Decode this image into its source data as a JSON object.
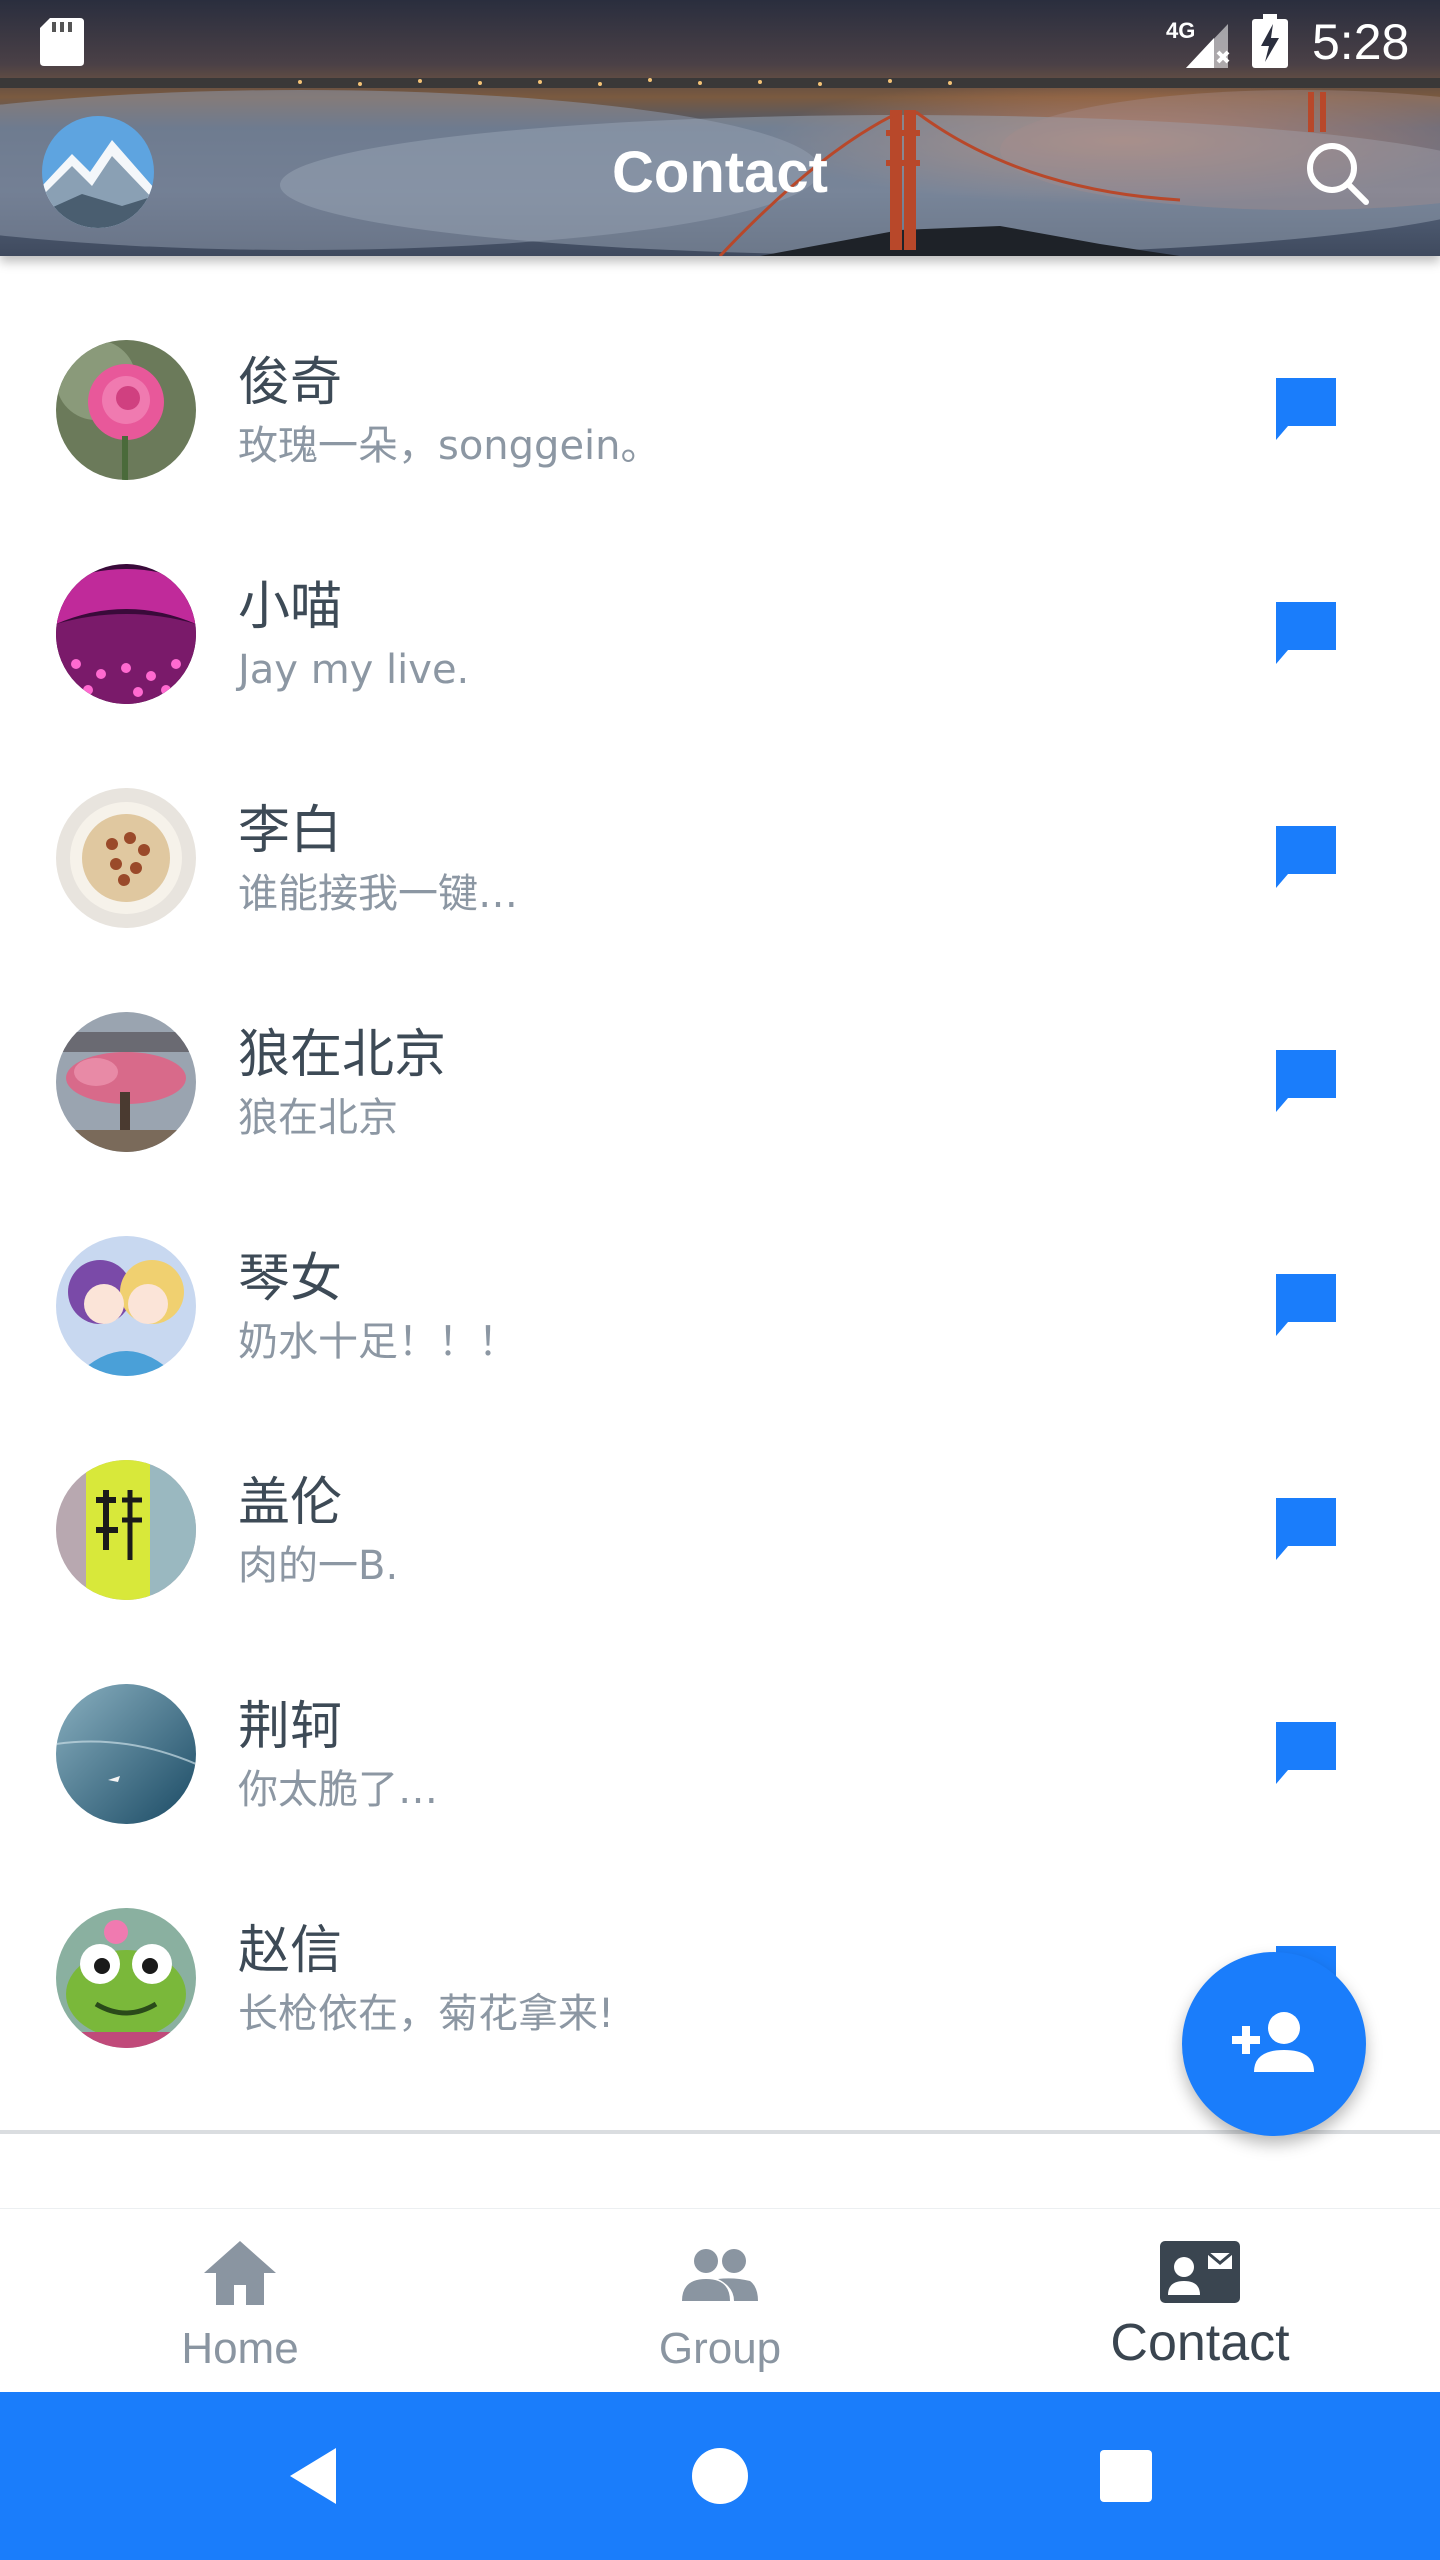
{
  "status_bar": {
    "time": "5:28",
    "network": "4G",
    "icons": [
      "sd-card-icon",
      "signal-icon",
      "battery-charging-icon"
    ]
  },
  "header": {
    "title": "Contact",
    "search_icon": "search-icon",
    "avatar": "profile-avatar"
  },
  "contacts": [
    {
      "name": "俊奇",
      "message": "玫瑰一朵，songgein。",
      "avatar": "rose"
    },
    {
      "name": "小喵",
      "message": "Jay my live.",
      "avatar": "concert"
    },
    {
      "name": "李白",
      "message": "谁能接我一键…",
      "avatar": "noodles"
    },
    {
      "name": "狼在北京",
      "message": "狼在北京",
      "avatar": "blossom-tree"
    },
    {
      "name": "琴女",
      "message": "奶水十足！！！",
      "avatar": "anime"
    },
    {
      "name": "盖伦",
      "message": "肉的一B.",
      "avatar": "can"
    },
    {
      "name": "荆轲",
      "message": "你太脆了…",
      "avatar": "sea"
    },
    {
      "name": "赵信",
      "message": "长枪依在，菊花拿来!",
      "avatar": "frog"
    }
  ],
  "fab": {
    "icon": "add-person-icon"
  },
  "tabs": [
    {
      "label": "Home",
      "icon": "home-icon",
      "active": false
    },
    {
      "label": "Group",
      "icon": "group-icon",
      "active": false
    },
    {
      "label": "Contact",
      "icon": "contact-card-icon",
      "active": true
    }
  ],
  "nav": {
    "icons": [
      "back-icon",
      "home-circle-icon",
      "recents-icon"
    ]
  },
  "colors": {
    "accent": "#1a7dfb",
    "name_text": "#3d4a56",
    "message_text": "#8c97a3",
    "tab_inactive": "#8a95a1",
    "tab_active": "#3a4550"
  }
}
